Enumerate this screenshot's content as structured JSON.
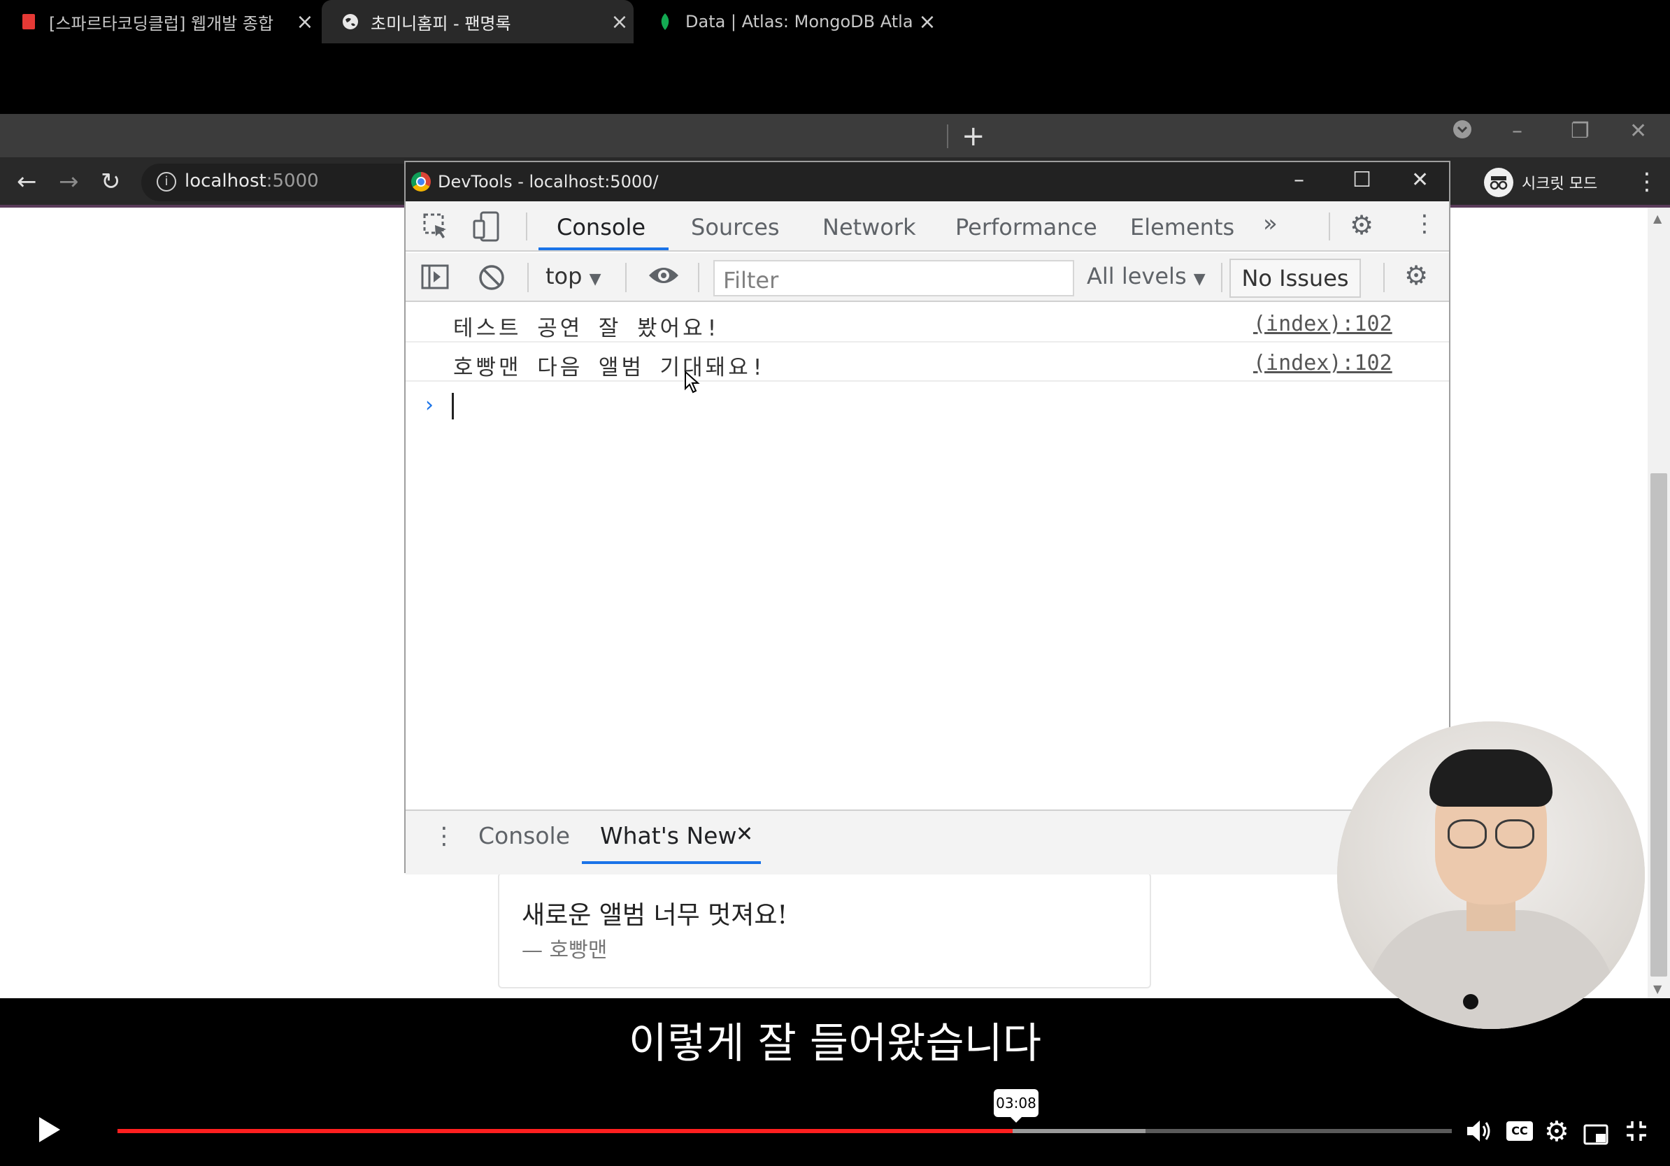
{
  "browser": {
    "tabs": [
      {
        "title": "[스파르타코딩클럽] 웹개발 종합",
        "active": false
      },
      {
        "title": "초미니홈피 - 팬명록",
        "active": true
      },
      {
        "title": "Data | Atlas: MongoDB Atlas",
        "active": false
      }
    ],
    "url_host": "localhost",
    "url_port": ":5000",
    "incognito_label": "시크릿 모드"
  },
  "devtools": {
    "title": "DevTools - localhost:5000/",
    "tabs": [
      "Console",
      "Sources",
      "Network",
      "Performance",
      "Elements"
    ],
    "active_tab": "Console",
    "context": "top",
    "filter_placeholder": "Filter",
    "levels": "All levels",
    "issues": "No Issues",
    "logs": [
      {
        "text": "테스트 공연 잘 봤어요!",
        "source": "(index):102"
      },
      {
        "text": "호빵맨 다음 앨범 기대돼요!",
        "source": "(index):102"
      }
    ],
    "drawer_tabs": [
      "Console",
      "What's New"
    ],
    "drawer_active": "What's New"
  },
  "page": {
    "card_message": "새로운 앨범 너무 멋져요!",
    "card_author": "— 호빵맨"
  },
  "video": {
    "subtitle": "이렇게 잘 들어왔습니다",
    "time_tooltip": "03:08",
    "progress_fraction": 0.671,
    "cc_label": "CC"
  },
  "colors": {
    "progress": "#ff1f1f",
    "devtools_accent": "#1a73e8"
  }
}
